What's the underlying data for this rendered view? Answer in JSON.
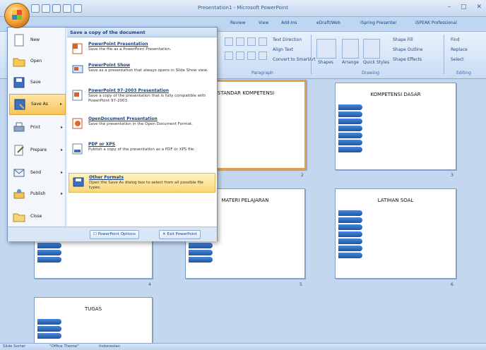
{
  "window": {
    "title": "Presentation1 - Microsoft PowerPoint",
    "controls": [
      "–",
      "□",
      "✕"
    ]
  },
  "ribbon": {
    "tabs": [
      "Review",
      "View",
      "Add-Ins",
      "eDraft/Web",
      "iSpring Presenter",
      "iSPEAK Professional"
    ],
    "groups": {
      "paragraph": "Paragraph",
      "drawing": "Drawing",
      "editing": "Editing"
    },
    "labels": {
      "text_direction": "Text Direction",
      "align_text": "Align Text",
      "convert_smartart": "Convert to SmartArt",
      "shape_fill": "Shape Fill",
      "shape_outline": "Shape Outline",
      "shape_effects": "Shape Effects",
      "shapes": "Shapes",
      "arrange": "Arrange",
      "quick_styles": "Quick Styles",
      "find": "Find",
      "replace": "Replace",
      "select": "Select"
    }
  },
  "office_menu": {
    "left_items": [
      {
        "label": "New",
        "icon": "new-document-icon",
        "has_arrow": false
      },
      {
        "label": "Open",
        "icon": "open-folder-icon",
        "has_arrow": false
      },
      {
        "label": "Save",
        "icon": "save-disk-icon",
        "has_arrow": false
      },
      {
        "label": "Save As",
        "icon": "save-as-icon",
        "has_arrow": true
      },
      {
        "label": "Print",
        "icon": "printer-icon",
        "has_arrow": true
      },
      {
        "label": "Prepare",
        "icon": "prepare-icon",
        "has_arrow": true
      },
      {
        "label": "Send",
        "icon": "send-icon",
        "has_arrow": true
      },
      {
        "label": "Publish",
        "icon": "publish-icon",
        "has_arrow": true
      },
      {
        "label": "Close",
        "icon": "close-folder-icon",
        "has_arrow": false
      }
    ],
    "right_header": "Save a copy of the document",
    "right_items": [
      {
        "title": "PowerPoint Presentation",
        "desc": "Save the file as a PowerPoint Presentation.",
        "icon": "pptx-icon"
      },
      {
        "title": "PowerPoint Show",
        "desc": "Save as a presentation that always opens in Slide Show view.",
        "icon": "ppsx-icon"
      },
      {
        "title": "PowerPoint 97-2003 Presentation",
        "desc": "Save a copy of the presentation that is fully compatible with PowerPoint 97-2003.",
        "icon": "ppt-icon"
      },
      {
        "title": "OpenDocument Presentation",
        "desc": "Save the presentation in the Open Document Format.",
        "icon": "odp-icon"
      },
      {
        "title": "PDF or XPS",
        "desc": "Publish a copy of the presentation as a PDF or XPS file.",
        "icon": "pdf-icon"
      },
      {
        "title": "Other Formats",
        "desc": "Open the Save As dialog box to select from all possible file types.",
        "icon": "other-formats-icon"
      }
    ],
    "options_button": "PowerPoint Options",
    "exit_button": "Exit PowerPoint"
  },
  "slides": [
    {
      "title": "STANDAR KOMPETENSI",
      "number": "2",
      "selected": true
    },
    {
      "title": "KOMPETENSI DASAR",
      "number": "3",
      "selected": false
    },
    {
      "title": "",
      "number": "4",
      "selected": false
    },
    {
      "title": "MATERI PELAJARAN",
      "number": "5",
      "selected": false
    },
    {
      "title": "LATIHAN SOAL",
      "number": "6",
      "selected": false
    },
    {
      "title": "",
      "number": "",
      "selected": false
    },
    {
      "title": "TUGAS",
      "number": "",
      "selected": false
    }
  ],
  "statusbar": {
    "slide_sorter": "Slide Sorter",
    "theme": "\"Office Theme\"",
    "language": "Indonesian"
  }
}
